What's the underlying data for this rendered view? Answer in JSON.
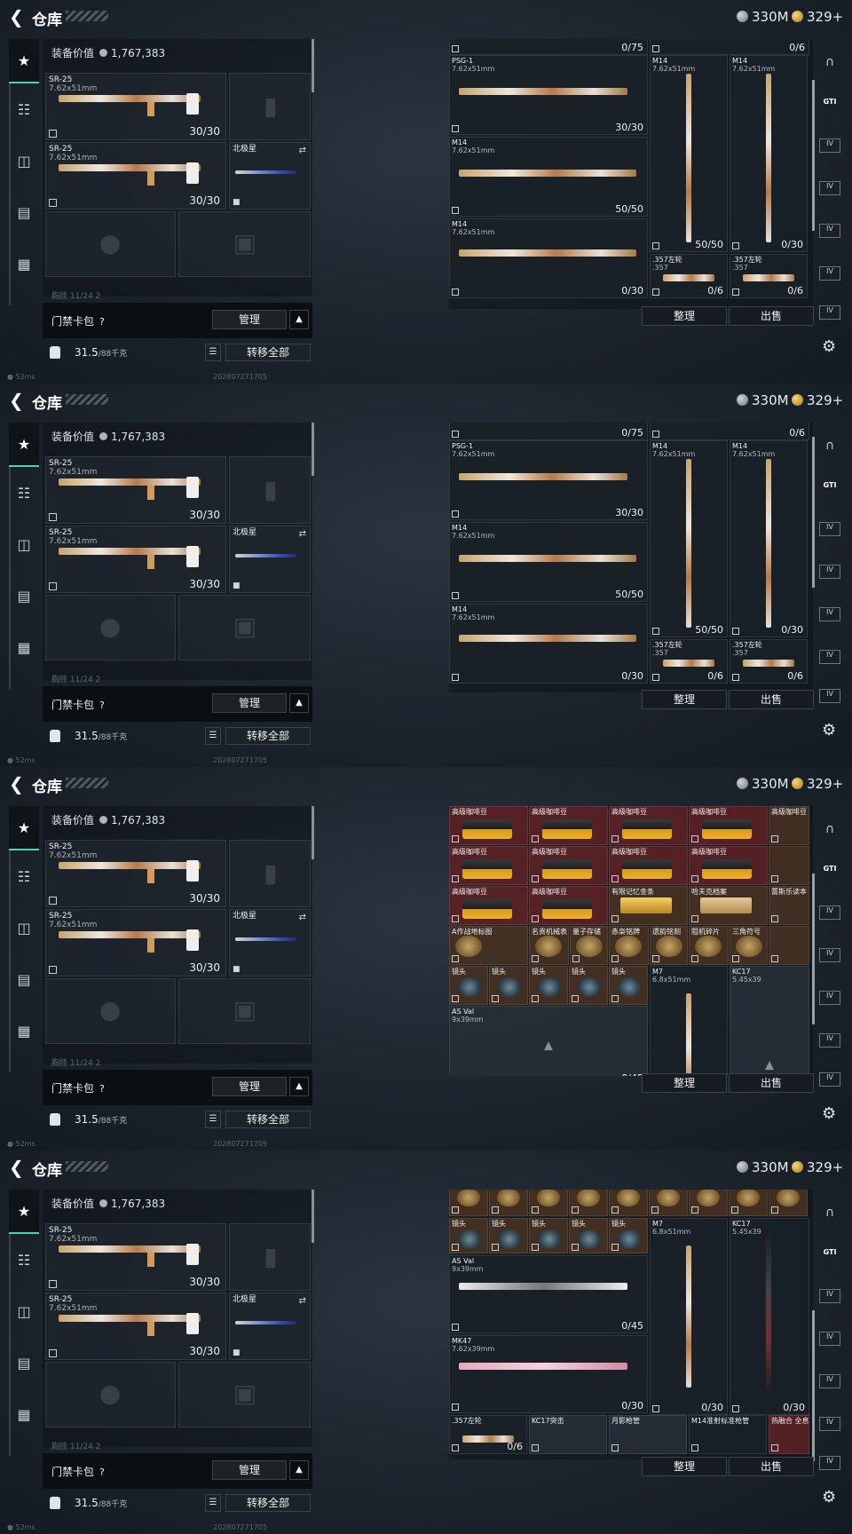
{
  "header": {
    "title": "仓库",
    "silver": "330M",
    "gold": "329+"
  },
  "left": {
    "equip_label": "装备价值",
    "equip_value": "1,767,383",
    "weapons": [
      {
        "name": "SR-25",
        "caliber": "7.62x51mm",
        "count": "30/30"
      },
      {
        "name": "SR-25",
        "caliber": "7.62x51mm",
        "count": "30/30"
      }
    ],
    "knife_label": "北极星",
    "faded": "胸挂 11/24 2",
    "card_label": "门禁卡包",
    "card_help": "?",
    "manage_label": "管理",
    "weight": "31.5",
    "weight_unit": "/88千克",
    "move_all_label": "转移全部"
  },
  "status": {
    "ping": "52ms",
    "build": "202807271705"
  },
  "right": {
    "sort_label": "整理",
    "sell_label": "出售",
    "f1": [
      {
        "name": "",
        "caliber": "",
        "count": "0/75"
      },
      {
        "name": "",
        "caliber": "",
        "count": "0/6"
      },
      {
        "name": "PSG-1",
        "caliber": "7.62x51mm",
        "count": "30/30"
      },
      {
        "name": "M14",
        "caliber": "7.62x51mm",
        "count": "50/50"
      },
      {
        "name": "M14",
        "caliber": "7.62x51mm",
        "count": "0/30"
      },
      {
        "name": "M14",
        "caliber": "7.62x51mm",
        "count": "50/50"
      },
      {
        "name": "M14",
        "caliber": "7.62x51mm",
        "count": "0/30"
      },
      {
        "name": ".357左轮",
        "caliber": ".357",
        "count": "0/6"
      },
      {
        "name": ".357左轮",
        "caliber": ".357",
        "count": "0/6"
      }
    ],
    "f3": {
      "coffee": "高级咖啡豆",
      "row3": [
        "高级咖啡豆",
        "高级咖啡豆",
        "有限记忆金条",
        "哈夫克档案",
        "蕾斯乐读本"
      ],
      "row4": [
        "A作战地标图",
        "名贵机械表",
        "量子存储",
        "赤枭铭牌",
        "遗韵铭刻",
        "阻机碎片",
        "三角符号"
      ],
      "scope": "镜头",
      "m7": {
        "name": "M7",
        "caliber": "6.8x51mm"
      },
      "kc17": {
        "name": "KC17",
        "caliber": "5.45x39"
      },
      "asval": {
        "name": "AS Val",
        "caliber": "9x39mm",
        "count": "0/45"
      },
      "mk47": {
        "name": "MK47",
        "caliber": "7.62x39mm"
      }
    },
    "f4": {
      "m7_count": "0/30",
      "kc17_count": "0/30",
      "mk47_count": "0/30",
      "revolver": {
        "name": ".357左轮",
        "count": "0/6"
      },
      "b1": "KC17突击",
      "b2": "月影枪管",
      "b3": "M14准射标准枪管",
      "b4": "热融合 全息"
    }
  }
}
